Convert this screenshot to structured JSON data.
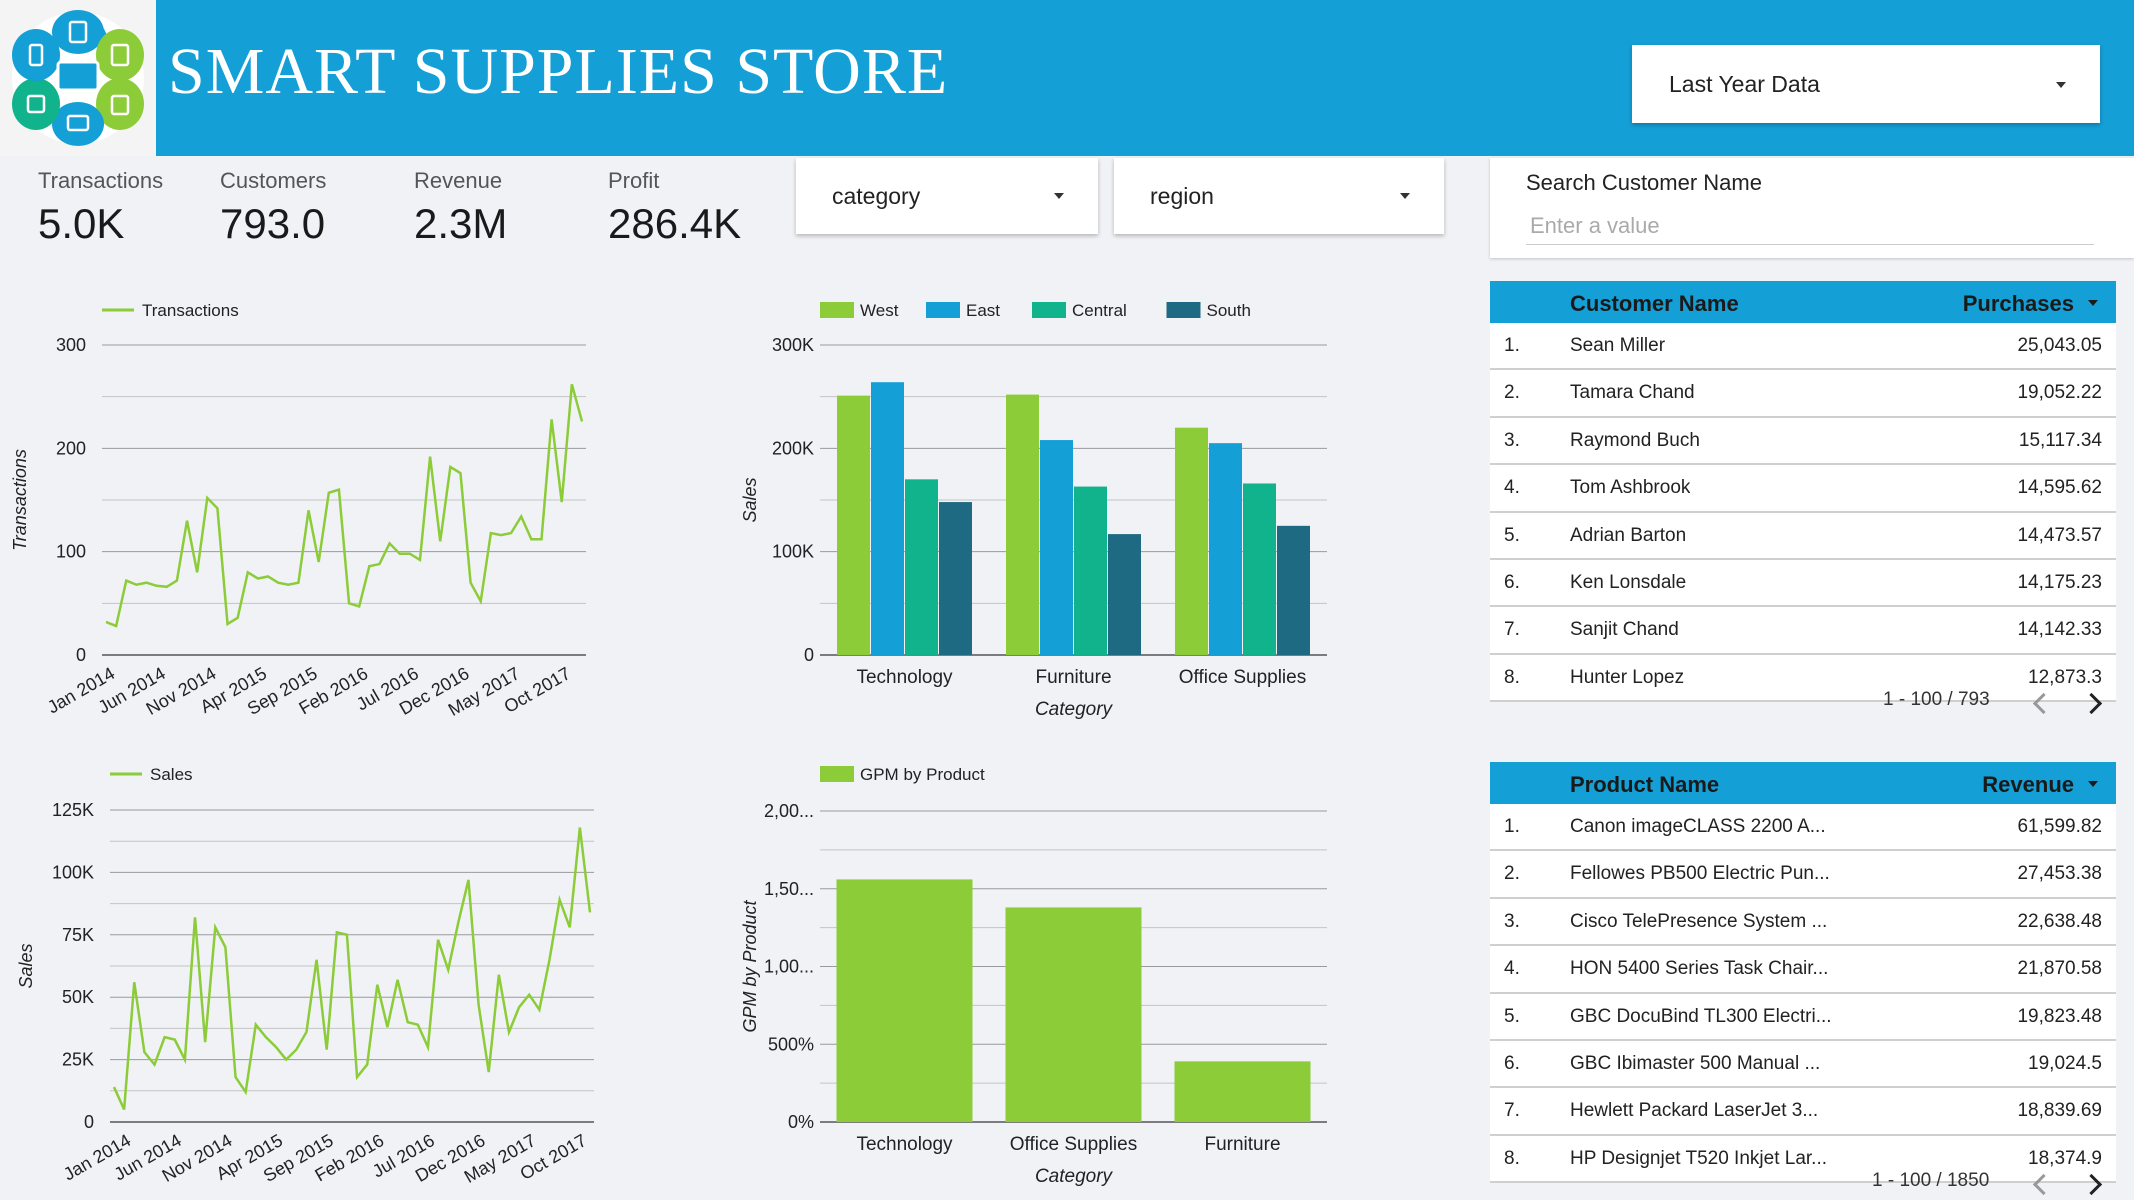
{
  "header": {
    "title": "SMART SUPPLIES STORE",
    "date_range": "Last Year Data"
  },
  "kpis": [
    {
      "label": "Transactions",
      "value": "5.0K"
    },
    {
      "label": "Customers",
      "value": "793.0"
    },
    {
      "label": "Revenue",
      "value": "2.3M"
    },
    {
      "label": "Profit",
      "value": "286.4K"
    }
  ],
  "filters": {
    "category": "category",
    "region": "region"
  },
  "search": {
    "title": "Search Customer Name",
    "placeholder": "Enter a value"
  },
  "customers_table": {
    "col1": "Customer Name",
    "col2": "Purchases",
    "rows": [
      {
        "idx": "1.",
        "name": "Sean Miller",
        "value": "25,043.05"
      },
      {
        "idx": "2.",
        "name": "Tamara Chand",
        "value": "19,052.22"
      },
      {
        "idx": "3.",
        "name": "Raymond Buch",
        "value": "15,117.34"
      },
      {
        "idx": "4.",
        "name": "Tom Ashbrook",
        "value": "14,595.62"
      },
      {
        "idx": "5.",
        "name": "Adrian Barton",
        "value": "14,473.57"
      },
      {
        "idx": "6.",
        "name": "Ken Lonsdale",
        "value": "14,175.23"
      },
      {
        "idx": "7.",
        "name": "Sanjit Chand",
        "value": "14,142.33"
      },
      {
        "idx": "8.",
        "name": "Hunter Lopez",
        "value": "12,873.3"
      }
    ],
    "pager": "1 - 100 / 793"
  },
  "products_table": {
    "col1": "Product Name",
    "col2": "Revenue",
    "rows": [
      {
        "idx": "1.",
        "name": "Canon imageCLASS 2200 A...",
        "value": "61,599.82"
      },
      {
        "idx": "2.",
        "name": "Fellowes PB500 Electric Pun...",
        "value": "27,453.38"
      },
      {
        "idx": "3.",
        "name": "Cisco TelePresence System ...",
        "value": "22,638.48"
      },
      {
        "idx": "4.",
        "name": "HON 5400 Series Task Chair...",
        "value": "21,870.58"
      },
      {
        "idx": "5.",
        "name": "GBC DocuBind TL300 Electri...",
        "value": "19,823.48"
      },
      {
        "idx": "6.",
        "name": "GBC Ibimaster 500 Manual ...",
        "value": "19,024.5"
      },
      {
        "idx": "7.",
        "name": "Hewlett Packard LaserJet 3...",
        "value": "18,839.69"
      },
      {
        "idx": "8.",
        "name": "HP Designjet T520 Inkjet Lar...",
        "value": "18,374.9"
      }
    ],
    "pager": "1 - 100 / 1850"
  },
  "colors": {
    "header": "#149fd6",
    "green": "#8ccc38",
    "blue": "#149fd6",
    "teal": "#10b38c",
    "navy": "#1e6a82"
  },
  "chart_data": [
    {
      "id": "transactions",
      "type": "line",
      "legend": [
        "Transactions"
      ],
      "ylabel": "Transactions",
      "ylim": [
        0,
        300
      ],
      "yticks": [
        "0",
        "100",
        "200",
        "300"
      ],
      "xtick_labels": [
        "Jan 2014",
        "Jun 2014",
        "Nov 2014",
        "Apr 2015",
        "Sep 2015",
        "Feb 2016",
        "Jul 2016",
        "Dec 2016",
        "May 2017",
        "Oct 2017"
      ],
      "series": [
        {
          "name": "Transactions",
          "values": [
            32,
            28,
            72,
            68,
            70,
            67,
            66,
            72,
            130,
            80,
            152,
            142,
            30,
            36,
            80,
            74,
            76,
            70,
            68,
            70,
            140,
            90,
            157,
            160,
            50,
            47,
            86,
            88,
            108,
            98,
            98,
            92,
            192,
            110,
            182,
            176,
            70,
            52,
            118,
            116,
            118,
            134,
            112,
            112,
            228,
            148,
            262,
            226
          ]
        }
      ]
    },
    {
      "id": "sales",
      "type": "line",
      "legend": [
        "Sales"
      ],
      "ylabel": "Sales",
      "ylim": [
        0,
        125000
      ],
      "yticks": [
        "0",
        "25K",
        "50K",
        "75K",
        "100K",
        "125K"
      ],
      "xtick_labels": [
        "Jan 2014",
        "Jun 2014",
        "Nov 2014",
        "Apr 2015",
        "Sep 2015",
        "Feb 2016",
        "Jul 2016",
        "Dec 2016",
        "May 2017",
        "Oct 2017"
      ],
      "series": [
        {
          "name": "Sales",
          "values": [
            14000,
            5000,
            56000,
            28000,
            23000,
            34000,
            33000,
            25000,
            82000,
            32000,
            78000,
            70000,
            18000,
            12000,
            39000,
            34000,
            30000,
            25000,
            29000,
            36000,
            65000,
            29000,
            76000,
            75000,
            18000,
            23000,
            55000,
            38000,
            57000,
            40000,
            39000,
            30000,
            73000,
            61000,
            80000,
            97000,
            47000,
            20000,
            59000,
            36000,
            46000,
            51000,
            45000,
            65000,
            89000,
            78000,
            118000,
            84000
          ]
        }
      ]
    },
    {
      "id": "sales-by-category",
      "type": "bar",
      "xlabel": "Category",
      "ylabel": "Sales",
      "ylim": [
        0,
        300000
      ],
      "yticks": [
        "0",
        "100K",
        "200K",
        "300K"
      ],
      "categories": [
        "Technology",
        "Furniture",
        "Office Supplies"
      ],
      "series": [
        {
          "name": "West",
          "values": [
            251000,
            252000,
            220000
          ]
        },
        {
          "name": "East",
          "values": [
            264000,
            208000,
            205000
          ]
        },
        {
          "name": "Central",
          "values": [
            170000,
            163000,
            166000
          ]
        },
        {
          "name": "South",
          "values": [
            148000,
            117000,
            125000
          ]
        }
      ]
    },
    {
      "id": "gpm-by-product",
      "type": "bar",
      "xlabel": "Category",
      "ylabel": "GPM by Product",
      "ytick_values": [
        0,
        500,
        1000,
        1500,
        2000
      ],
      "yticks": [
        "0%",
        "500%",
        "1,00...",
        "1,50...",
        "2,00..."
      ],
      "ylim": [
        0,
        2000
      ],
      "categories": [
        "Technology",
        "Office Supplies",
        "Furniture"
      ],
      "series": [
        {
          "name": "GPM by Product",
          "values": [
            1560,
            1380,
            390
          ]
        }
      ]
    }
  ]
}
